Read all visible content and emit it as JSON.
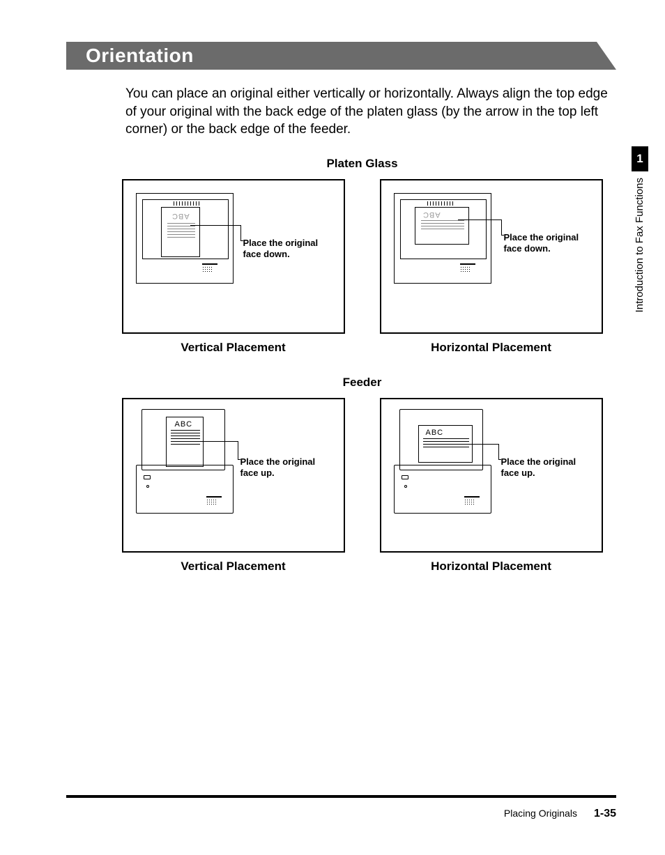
{
  "header": {
    "title": "Orientation"
  },
  "intro": "You can place an original either vertically or horizontally. Always align the top edge of your original with the back edge of the platen glass (by the arrow in the top left corner) or the back edge of the feeder.",
  "sections": {
    "platen": {
      "title": "Platen Glass",
      "left": {
        "callout1": "Place the original",
        "callout2": "face down.",
        "abc": "ABC",
        "caption": "Vertical Placement"
      },
      "right": {
        "callout1": "Place the original",
        "callout2": "face down.",
        "abc": "ABC",
        "caption": "Horizontal Placement"
      }
    },
    "feeder": {
      "title": "Feeder",
      "left": {
        "callout1": "Place the original",
        "callout2": "face up.",
        "abc": "ABC",
        "caption": "Vertical Placement"
      },
      "right": {
        "callout1": "Place the original",
        "callout2": "face up.",
        "abc": "ABC",
        "caption": "Horizontal Placement"
      }
    }
  },
  "sidebar": {
    "chapter_number": "1",
    "chapter_title": "Introduction to Fax Functions"
  },
  "footer": {
    "section": "Placing Originals",
    "page": "1-35"
  }
}
